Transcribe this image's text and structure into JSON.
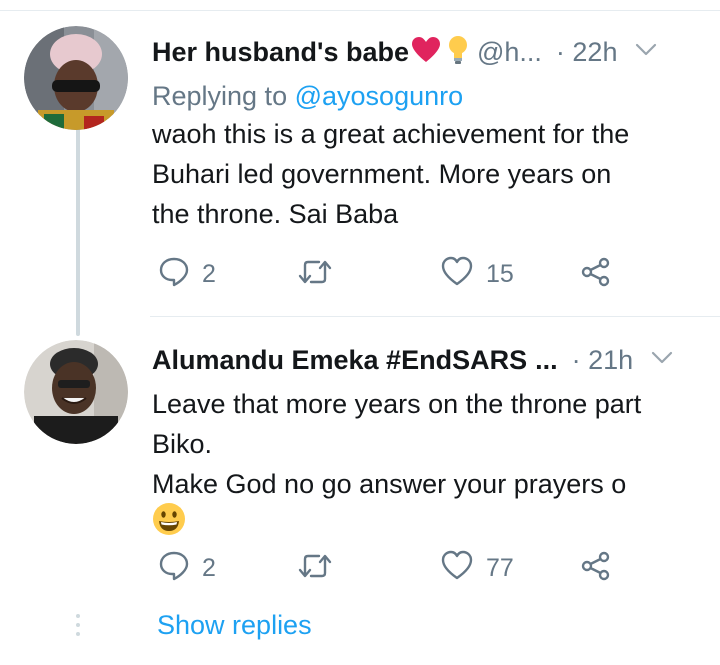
{
  "tweets": [
    {
      "name": "Her husband's babe",
      "name_emojis": [
        "red-heart",
        "light-bulb"
      ],
      "handle": "@h...",
      "time": "· 22h",
      "replying_label": "Replying to",
      "replying_to": "@ayosogunro",
      "body_lines": [
        "waoh this is a great achievement for the",
        "Buhari led government. More years on",
        "the throne. Sai Baba"
      ],
      "replies": "2",
      "likes": "15"
    },
    {
      "name": "Alumandu Emeka #EndSARS",
      "name_suffix": "...",
      "time": "· 21h",
      "body_lines": [
        "Leave that more years on the throne part",
        "Biko.",
        "Make God no go answer your prayers o"
      ],
      "body_emoji": "grinning-face",
      "replies": "2",
      "likes": "77"
    }
  ],
  "show_replies": "Show replies",
  "colors": {
    "accent": "#1da1f2",
    "secondary": "#657786",
    "text": "#14171a",
    "divider": "#e6ecf0"
  },
  "icons": [
    "chevron-down-icon",
    "reply-icon",
    "retweet-icon",
    "like-icon",
    "share-icon"
  ]
}
